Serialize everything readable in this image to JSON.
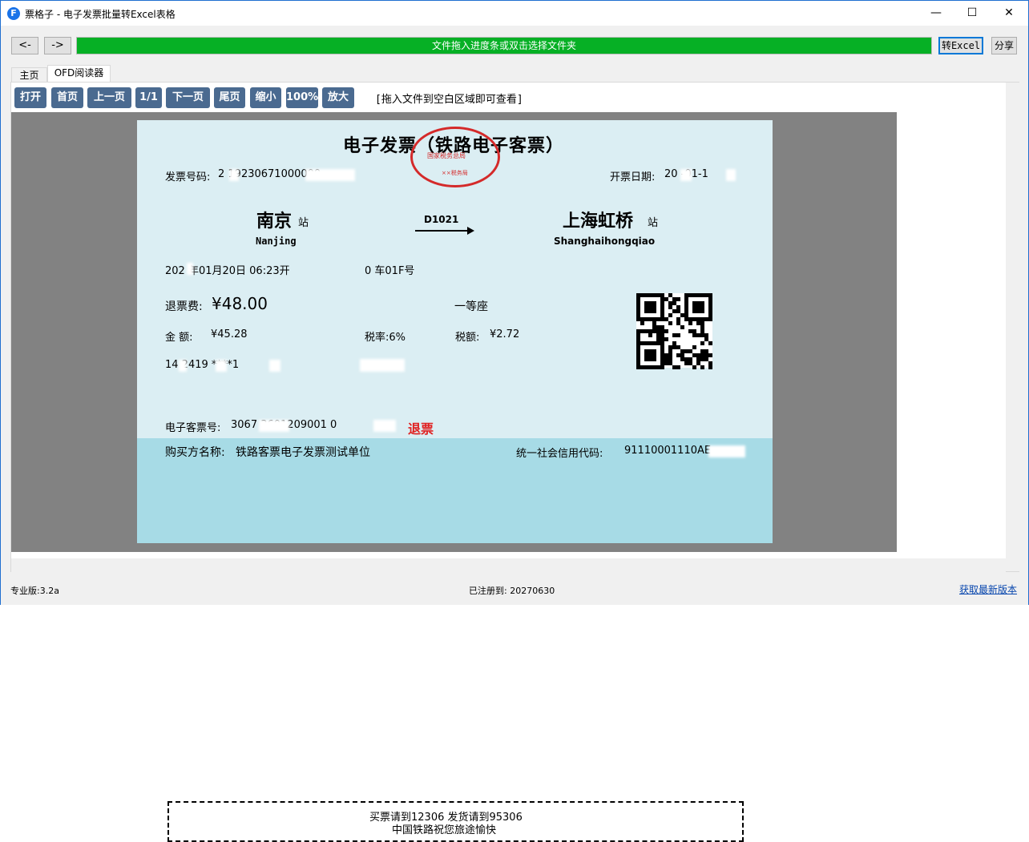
{
  "window": {
    "title": "票格子 - 电子发票批量转Excel表格",
    "icon_letter": "F"
  },
  "controls": {
    "back": "<-",
    "forward": "->",
    "minimize": "—",
    "maximize": "☐",
    "close": "✕"
  },
  "progress": {
    "label": "文件拖入进度条或双击选择文件夹",
    "fill_percent": 100,
    "color": "#06b025"
  },
  "actions": {
    "to_excel": "转Excel",
    "share": "分享"
  },
  "tabs": [
    {
      "label": "主页"
    },
    {
      "label": "OFD阅读器",
      "active": true
    }
  ],
  "toolbar": {
    "buttons": [
      "打开",
      "首页",
      "上一页",
      "1/1",
      "下一页",
      "尾页",
      "缩小",
      "100%",
      "放大"
    ],
    "hint": "[拖入文件到空白区域即可查看]"
  },
  "ticket": {
    "title": "电子发票（铁路电子客票）",
    "stamp_line1": "国家税务总局",
    "stamp_line2": "××税务局",
    "invoice_no_label": "发票号码:",
    "invoice_no": "2  19230671000000",
    "date_label": "开票日期:",
    "date": "20  -01-1",
    "from_station": "南京",
    "from_suffix": "站",
    "from_pinyin": "Nanjing",
    "train_no": "D1021",
    "to_station": "上海虹桥",
    "to_suffix": "站",
    "to_pinyin": "Shanghaihongqiao",
    "departure": "202  年01月20日   06:23开",
    "seat": "0 车01F号",
    "refund_label": "退票费:",
    "refund_amount": "¥48.00",
    "seat_class": "一等座",
    "amount_label": "金  额:",
    "amount": "¥45.28",
    "tax_rate": "税率:6%",
    "tax_amount_label": "税额:",
    "tax_amount": "¥2.72",
    "id_line": "14  2419  ****1",
    "eticket_label": "电子客票号:",
    "eticket_no": "3067    3601209001    0",
    "refund_stamp": "退票",
    "buyer_label": "购买方名称:",
    "buyer": "铁路客票电子发票测试单位",
    "credit_label": "统一社会信用代码:",
    "credit_code": "91110001110AE",
    "footer_line1": "买票请到12306 发货请到95306",
    "footer_line2": "中国铁路祝您旅途愉快"
  },
  "status": {
    "version": "专业版:3.2a",
    "registered": "已注册到: 20270630",
    "update_link": "获取最新版本"
  }
}
